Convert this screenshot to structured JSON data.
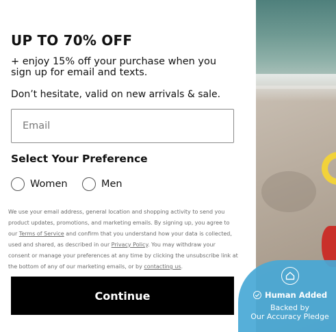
{
  "promo": {
    "headline": "UP TO 70% OFF",
    "subline": "+ enjoy 15% off your purchase when you sign up for email and texts.",
    "note": "Don’t hesitate, valid on new arrivals & sale."
  },
  "email": {
    "placeholder": "Email",
    "value": ""
  },
  "preference": {
    "title": "Select Your Preference",
    "options": [
      {
        "label": "Women",
        "selected": false
      },
      {
        "label": "Men",
        "selected": false
      }
    ]
  },
  "legal": {
    "part1": "We use your email address, general location and shopping activity to send you product updates, promotions, and marketing emails. By signing up, you agree to our ",
    "terms_link": "Terms of Service",
    "part2": " and confirm that you understand how your data is collected, used and shared, as described in our ",
    "privacy_link": "Privacy Policy",
    "part3": ". You may withdraw your consent or manage your preferences at any time by clicking the unsubscribe link at the bottom of any of our marketing emails, or by ",
    "contact_link": "contacting us",
    "part4": "."
  },
  "continue_label": "Continue",
  "badge": {
    "icon": "house-shield-icon",
    "title": "Human Added",
    "subtitle_line1": "Backed by",
    "subtitle_line2": "Our Accuracy Pledge",
    "color": "#48a8d6"
  },
  "colors": {
    "button": "#000000",
    "accent_yellow": "#f2d23a",
    "accent_red": "#c9302a"
  }
}
